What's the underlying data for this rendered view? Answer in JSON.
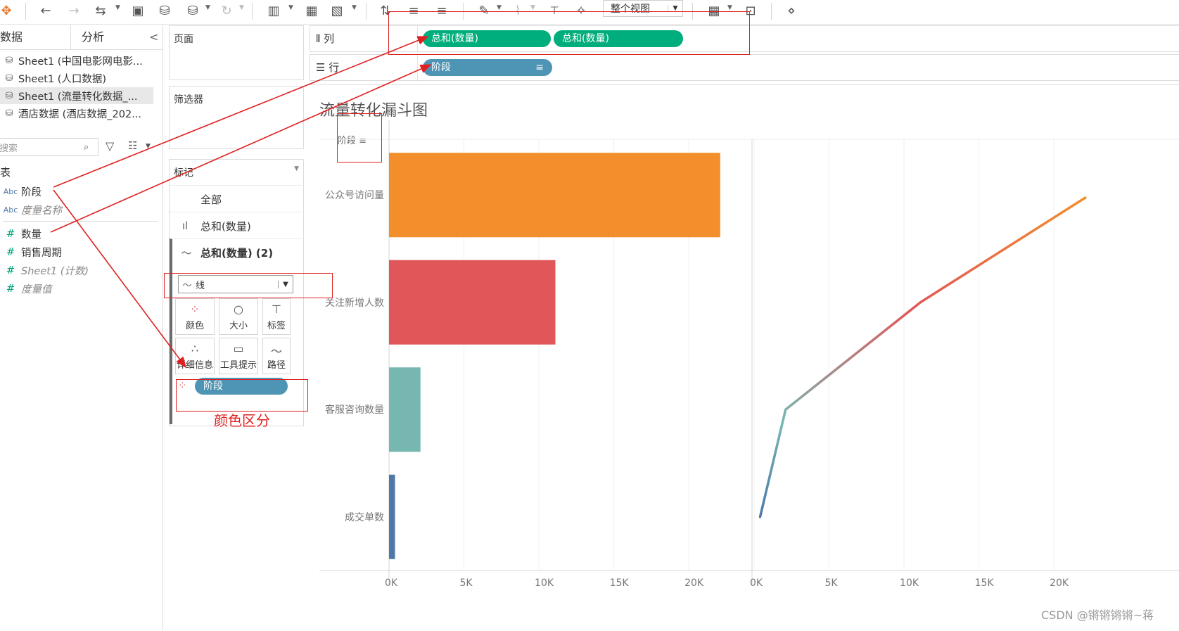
{
  "toolbar": {
    "view_dropdown": "整个视图",
    "icons": [
      "tableau-logo-icon",
      "back-icon",
      "forward-icon",
      "redo-icon",
      "save-icon",
      "new-datasource-icon",
      "pause-icon",
      "refresh-icon",
      "new-sheet-icon",
      "duplicate-sheet-icon",
      "clear-sheet-icon",
      "swap-icon",
      "sort-ascending-icon",
      "sort-descending-icon",
      "highlight-icon",
      "attach-icon",
      "label-icon",
      "pin-icon",
      "show-me-icon",
      "presentation-icon",
      "share-icon"
    ]
  },
  "left_panel": {
    "tabs": [
      "数据",
      "分析"
    ],
    "collapse_glyph": "<",
    "datasources": [
      "Sheet1 (中国电影网电影...",
      "Sheet1 (人口数据)",
      "Sheet1 (流量转化数据_...",
      "酒店数据 (酒店数据_202..."
    ],
    "search_placeholder": "搜索",
    "section_label": "表",
    "fields": [
      {
        "type": "Abc",
        "name": "阶段"
      },
      {
        "type": "Abc",
        "name": "度量名称"
      },
      {
        "type": "#",
        "name": "数量"
      },
      {
        "type": "#",
        "name": "销售周期"
      },
      {
        "type": "#",
        "name": "Sheet1 (计数)"
      },
      {
        "type": "#",
        "name": "度量值"
      }
    ]
  },
  "shelves": {
    "pages_label": "页面",
    "filters_label": "筛选器",
    "marks": {
      "title": "标记",
      "rows": [
        "全部",
        "总和(数量)",
        "总和(数量) (2)"
      ],
      "mark_type": "线",
      "buttons": [
        "颜色",
        "大小",
        "标签",
        "详细信息",
        "工具提示",
        "路径"
      ],
      "color_pill": "阶段"
    }
  },
  "columns_shelf": {
    "label": "列",
    "pills": [
      "总和(数量)",
      "总和(数量)"
    ]
  },
  "rows_shelf": {
    "label": "行",
    "pills": [
      "阶段"
    ]
  },
  "annotation": {
    "text": "颜色区分",
    "color": "#e02020"
  },
  "chart_data": {
    "type": "bar",
    "title": "流量转化漏斗图",
    "y_header": "阶段",
    "categories": [
      "公众号访问量",
      "关注新增人数",
      "客服咨询数量",
      "成交单数"
    ],
    "values": [
      22100,
      11100,
      2100,
      400
    ],
    "colors": [
      "#f28e2b",
      "#e15759",
      "#76b7b2",
      "#4e79a7"
    ],
    "xlim": [
      0,
      23000
    ],
    "x_ticks": [
      "0K",
      "5K",
      "10K",
      "15K",
      "20K"
    ],
    "line_series": {
      "type": "line",
      "values": [
        22100,
        11100,
        2100,
        400
      ],
      "xlim": [
        0,
        23000
      ],
      "x_ticks": [
        "0K",
        "5K",
        "10K",
        "15K",
        "20K"
      ]
    }
  },
  "watermark": "CSDN @锵锵锵锵~蒋"
}
